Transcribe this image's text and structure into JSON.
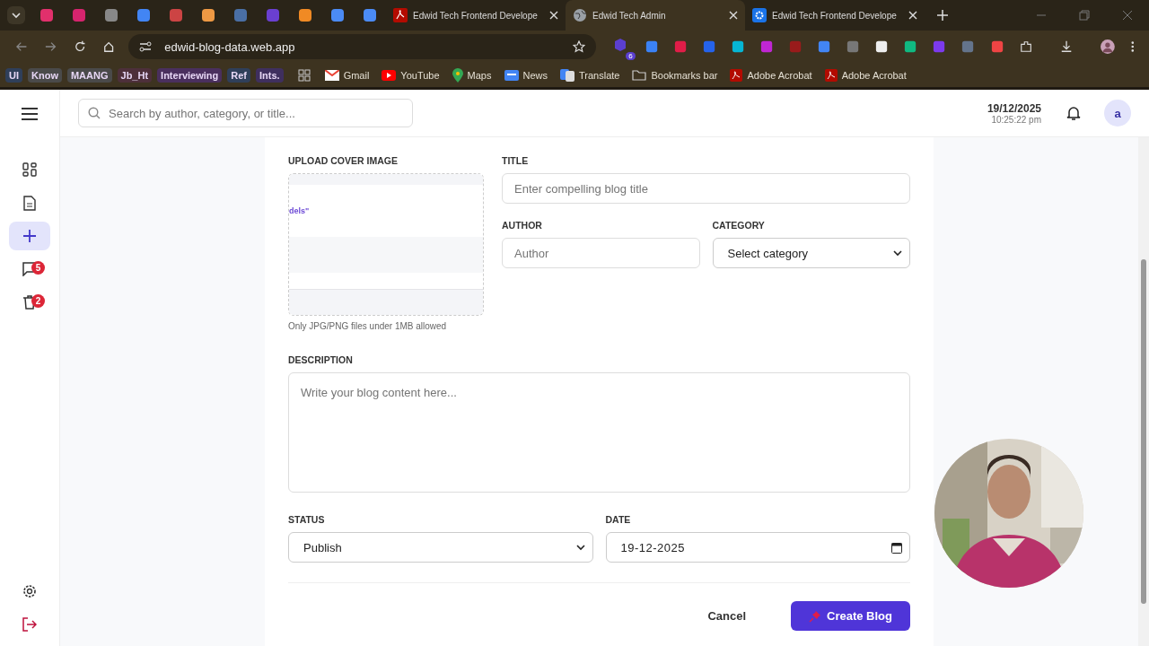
{
  "browser": {
    "tabs": [
      {
        "title": "Edwid Tech Frontend Develope",
        "kind": "pdf",
        "selected": false
      },
      {
        "title": "Edwid Tech Admin",
        "kind": "globe",
        "selected": true
      },
      {
        "title": "Edwid Tech Frontend Develope",
        "kind": "gear",
        "selected": false
      }
    ],
    "url": "edwid-blog-data.web.app",
    "extension_badge": "6",
    "bookmarks": [
      {
        "label": "UI",
        "kind": "chip",
        "color": "#2f3f5a"
      },
      {
        "label": "Know",
        "kind": "chip",
        "color": "#4a4a4a"
      },
      {
        "label": "MAANG",
        "kind": "chip",
        "color": "#4a4a4a"
      },
      {
        "label": "Jb_Ht",
        "kind": "chip",
        "color": "#4d2f3a"
      },
      {
        "label": "Interviewing",
        "kind": "chip",
        "color": "#4a2f5e"
      },
      {
        "label": "Ref",
        "kind": "chip",
        "color": "#2f3f5a"
      },
      {
        "label": "Ints.",
        "kind": "chip",
        "color": "#3f2f5e"
      },
      {
        "label": "Gmail",
        "kind": "mail"
      },
      {
        "label": "YouTube",
        "kind": "play"
      },
      {
        "label": "Maps",
        "kind": "pin"
      },
      {
        "label": "News",
        "kind": "news"
      },
      {
        "label": "Translate",
        "kind": "translate"
      },
      {
        "label": "Bookmarks bar",
        "kind": "folder"
      },
      {
        "label": "Adobe Acrobat",
        "kind": "pdf"
      },
      {
        "label": "Adobe Acrobat",
        "kind": "pdf"
      }
    ]
  },
  "header": {
    "search": {
      "placeholder": "Search by author, category, or title..."
    },
    "date": "19/12/2025",
    "time": "10:25:22 pm",
    "avatar": "a"
  },
  "sidebar": {
    "items": [
      {
        "kind": "dashboard",
        "selected": false
      },
      {
        "kind": "document",
        "selected": false
      },
      {
        "kind": "add",
        "selected": true
      },
      {
        "kind": "comments",
        "selected": false,
        "badge": "5"
      },
      {
        "kind": "trash",
        "selected": false,
        "badge": "2"
      }
    ],
    "bottom": [
      {
        "kind": "settings"
      },
      {
        "kind": "logout"
      }
    ]
  },
  "form": {
    "cover": {
      "label": "UPLOAD COVER IMAGE",
      "preview_text": "dels\"",
      "hint": "Only JPG/PNG files under 1MB allowed"
    },
    "title": {
      "label": "TITLE",
      "placeholder": "Enter compelling blog title"
    },
    "author": {
      "label": "AUTHOR",
      "placeholder": "Author"
    },
    "category": {
      "label": "CATEGORY",
      "value": "Select category"
    },
    "description": {
      "label": "DESCRIPTION",
      "placeholder": "Write your blog content here..."
    },
    "status": {
      "label": "STATUS",
      "value": "Publish"
    },
    "date": {
      "label": "DATE",
      "value": "19-12-2025"
    },
    "cancel": "Cancel",
    "submit": "Create Blog"
  }
}
